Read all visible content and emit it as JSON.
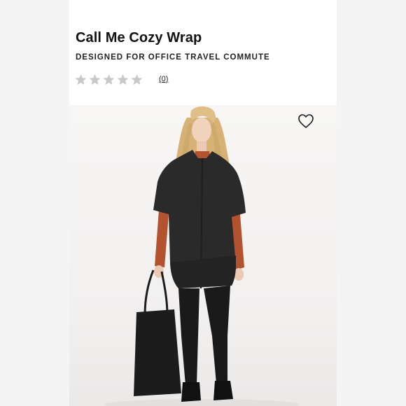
{
  "product": {
    "title": "Call Me Cozy Wrap",
    "subtitle": "DESIGNED FOR OFFICE TRAVEL COMMUTE"
  },
  "rating": {
    "stars_filled": 0,
    "stars_total": 5,
    "review_count_label": "(0)",
    "star_color": "#c8c8c8"
  },
  "wishlist": {
    "icon": "heart-outline-icon"
  },
  "image": {
    "subject": "model-wearing-wrap-photo",
    "wrap_color": "#2b2a2a",
    "sleeve_color": "#b2522f",
    "bag_color": "#1c1c1c",
    "hair_color": "#d9b57b"
  }
}
